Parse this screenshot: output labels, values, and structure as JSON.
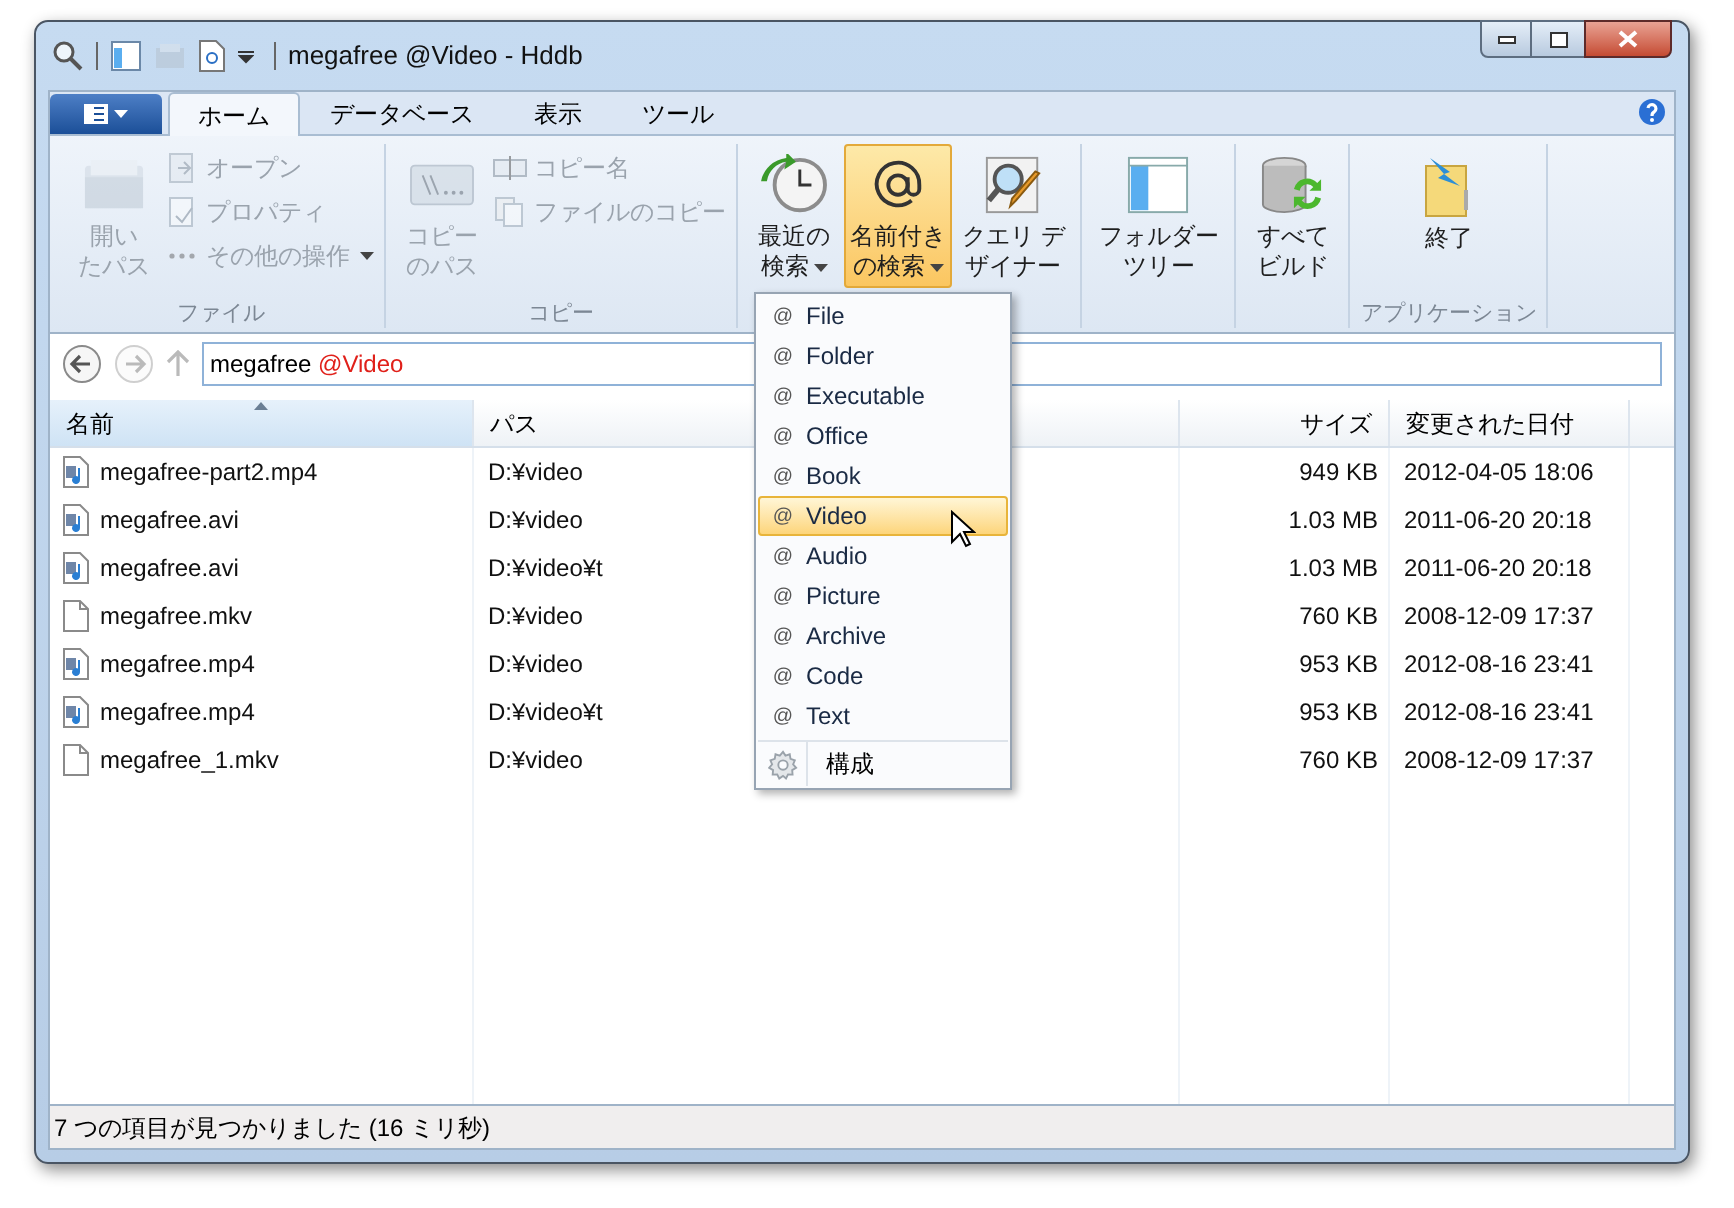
{
  "window": {
    "title": "megafree @Video - Hddb"
  },
  "tabs": [
    {
      "label": "ホーム",
      "selected": true
    },
    {
      "label": "データベース",
      "selected": false
    },
    {
      "label": "表示",
      "selected": false
    },
    {
      "label": "ツール",
      "selected": false
    }
  ],
  "ribbon_groups": [
    {
      "label": "ファイル",
      "items": [
        {
          "kind": "large",
          "lines": [
            "開い",
            "たパス"
          ],
          "disabled": true,
          "dropdown": false,
          "pressed": false
        },
        {
          "kind": "small",
          "lines": [
            "オープン"
          ],
          "disabled": true,
          "dropdown": false
        },
        {
          "kind": "small",
          "lines": [
            "プロパティ"
          ],
          "disabled": true,
          "dropdown": false
        },
        {
          "kind": "small",
          "lines": [
            "その他の操作"
          ],
          "disabled": true,
          "dropdown": true
        }
      ]
    },
    {
      "label": "コピー",
      "items": [
        {
          "kind": "large",
          "lines": [
            "コピー",
            "のパス"
          ],
          "disabled": true,
          "dropdown": false,
          "pressed": false
        },
        {
          "kind": "small",
          "lines": [
            "コピー名"
          ],
          "disabled": true,
          "dropdown": false
        },
        {
          "kind": "small",
          "lines": [
            "ファイルのコピー"
          ],
          "disabled": true,
          "dropdown": false
        }
      ]
    },
    {
      "items": [
        {
          "kind": "large",
          "lines": [
            "最近の",
            "検索"
          ],
          "disabled": false,
          "dropdown": true,
          "pressed": false
        },
        {
          "kind": "large",
          "lines": [
            "名前付き",
            "の検索"
          ],
          "disabled": false,
          "dropdown": true,
          "pressed": true
        },
        {
          "kind": "large",
          "lines": [
            "クエリ デ",
            "ザイナー"
          ],
          "disabled": false,
          "dropdown": false,
          "pressed": false
        }
      ]
    },
    {
      "items": [
        {
          "kind": "large",
          "lines": [
            "フォルダー",
            "ツリー"
          ],
          "disabled": false,
          "dropdown": false,
          "pressed": false
        }
      ]
    },
    {
      "items": [
        {
          "kind": "large",
          "lines": [
            "すべて",
            "ビルド"
          ],
          "disabled": false,
          "dropdown": false,
          "pressed": false
        }
      ]
    },
    {
      "label": "アプリケーション",
      "items": [
        {
          "kind": "large",
          "lines": [
            "終了"
          ],
          "disabled": false,
          "dropdown": false,
          "pressed": false
        }
      ]
    }
  ],
  "address_bar": {
    "query": "megafree",
    "tag": "@Video"
  },
  "named_search_menu": {
    "items": [
      {
        "label": "File",
        "selected": false
      },
      {
        "label": "Folder",
        "selected": false
      },
      {
        "label": "Executable",
        "selected": false
      },
      {
        "label": "Office",
        "selected": false
      },
      {
        "label": "Book",
        "selected": false
      },
      {
        "label": "Video",
        "selected": true
      },
      {
        "label": "Audio",
        "selected": false
      },
      {
        "label": "Picture",
        "selected": false
      },
      {
        "label": "Archive",
        "selected": false
      },
      {
        "label": "Code",
        "selected": false
      },
      {
        "label": "Text",
        "selected": false
      }
    ],
    "marker": "@",
    "footer": "構成"
  },
  "table": {
    "columns": [
      {
        "label": "名前",
        "sorted": true
      },
      {
        "label": "パス",
        "sorted": false
      },
      {
        "label": "サイズ",
        "sorted": false
      },
      {
        "label": "変更された日付",
        "sorted": false
      }
    ],
    "rows": [
      {
        "kind": "media",
        "name": "megafree-part2.mp4",
        "path": "D:¥video",
        "size": "949 KB",
        "modified": "2012-04-05 18:06"
      },
      {
        "kind": "media",
        "name": "megafree.avi",
        "path": "D:¥video",
        "size": "1.03 MB",
        "modified": "2011-06-20 20:18"
      },
      {
        "kind": "media",
        "name": "megafree.avi",
        "path": "D:¥video¥t",
        "size": "1.03 MB",
        "modified": "2011-06-20 20:18"
      },
      {
        "kind": "plain",
        "name": "megafree.mkv",
        "path": "D:¥video",
        "size": "760 KB",
        "modified": "2008-12-09 17:37"
      },
      {
        "kind": "media",
        "name": "megafree.mp4",
        "path": "D:¥video",
        "size": "953 KB",
        "modified": "2012-08-16 23:41"
      },
      {
        "kind": "media",
        "name": "megafree.mp4",
        "path": "D:¥video¥t",
        "size": "953 KB",
        "modified": "2012-08-16 23:41"
      },
      {
        "kind": "plain",
        "name": "megafree_1.mkv",
        "path": "D:¥video",
        "size": "760 KB",
        "modified": "2008-12-09 17:37"
      }
    ]
  },
  "status_bar": {
    "text": "7 つの項目が見つかりました (16 ミリ秒)"
  }
}
